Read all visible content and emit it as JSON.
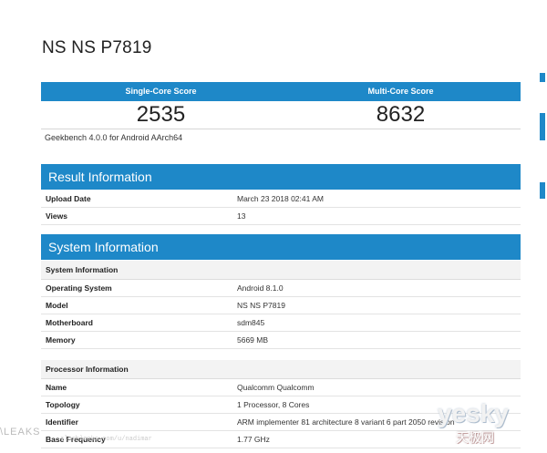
{
  "title": "NS NS P7819",
  "scores": {
    "single_label": "Single-Core Score",
    "multi_label": "Multi-Core Score",
    "single_value": "2535",
    "multi_value": "8632",
    "footer": "Geekbench 4.0.0 for Android AArch64"
  },
  "result_info": {
    "title": "Result Information",
    "rows": [
      {
        "key": "Upload Date",
        "value": "March 23 2018 02:41 AM"
      },
      {
        "key": "Views",
        "value": "13"
      }
    ]
  },
  "system_info": {
    "title": "System Information",
    "sub1": "System Information",
    "rows1": [
      {
        "key": "Operating System",
        "value": "Android 8.1.0"
      },
      {
        "key": "Model",
        "value": "NS NS P7819"
      },
      {
        "key": "Motherboard",
        "value": "sdm845"
      },
      {
        "key": "Memory",
        "value": "5669 MB"
      }
    ],
    "sub2": "Processor Information",
    "rows2": [
      {
        "key": "Name",
        "value": "Qualcomm Qualcomm"
      },
      {
        "key": "Topology",
        "value": "1 Processor, 8 Cores"
      },
      {
        "key": "Identifier",
        "value": "ARM implementer 81 architecture 8 variant 6 part 2050 revision"
      },
      {
        "key": "Base Frequency",
        "value": "1.77 GHz"
      }
    ]
  },
  "watermarks": {
    "left": "\\LEAKS",
    "url": "slashleaks.com/u/nadimar",
    "logo": "yesky",
    "logo_sub": "天极网"
  }
}
